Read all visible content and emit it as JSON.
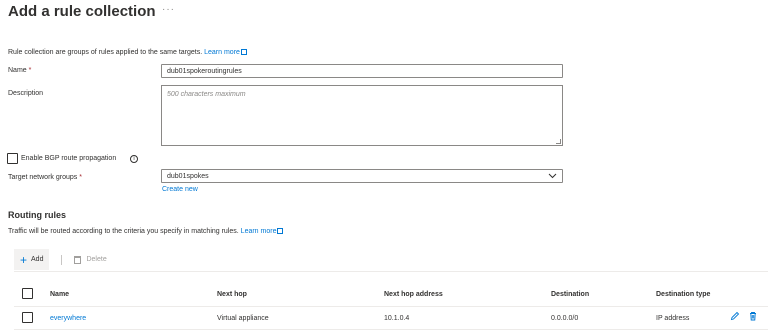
{
  "page": {
    "title": "Add a rule collection",
    "ellipsis": "···"
  },
  "intro": {
    "text": "Rule collection are groups of rules applied to the same targets.",
    "learn_more": "Learn more"
  },
  "form": {
    "name_label": "Name",
    "required_mark": "*",
    "name_value": "dub01spokeroutingrules",
    "description_label": "Description",
    "description_placeholder": "500 characters maximum",
    "bgp_label": "Enable BGP route propagation",
    "bgp_info": "i",
    "target_label": "Target network groups",
    "target_value": "dub01spokes",
    "create_new": "Create new"
  },
  "routing": {
    "heading": "Routing rules",
    "intro": "Traffic will be routed according to the criteria you specify in matching rules.",
    "learn_more": "Learn more",
    "add_label": "Add",
    "delete_label": "Delete"
  },
  "table": {
    "headers": [
      "Name",
      "Next hop",
      "Next hop address",
      "Destination",
      "Destination type"
    ],
    "rows": [
      {
        "name": "everywhere",
        "next_hop": "Virtual appliance",
        "next_hop_address": "10.1.0.4",
        "destination": "0.0.0.0/0",
        "destination_type": "IP address"
      }
    ]
  },
  "colors": {
    "accent": "#0078d4",
    "text": "#323130",
    "muted": "#a19f9d",
    "border": "#8a8886"
  }
}
